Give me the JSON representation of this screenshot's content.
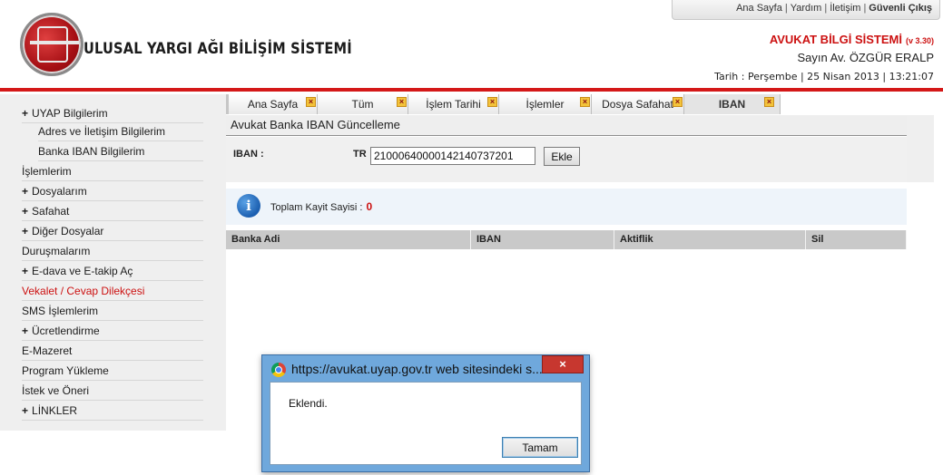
{
  "header": {
    "site_title": "ULUSAL YARGI AĞI BİLİŞİM SİSTEMİ",
    "top_links": [
      "Ana Sayfa",
      "Yardım",
      "İletişim"
    ],
    "logout": "Güvenli Çıkış",
    "system_name": "AVUKAT BİLGİ SİSTEMİ",
    "version": "(v 3.30)",
    "user": "Sayın Av. ÖZGÜR ERALP",
    "date": "Tarih : Perşembe | 25 Nisan 2013 | 13:21:07"
  },
  "sidebar": {
    "items": [
      {
        "label": "UYAP Bilgilerim",
        "plus": "+"
      },
      {
        "label": "Adres ve İletişim Bilgilerim"
      },
      {
        "label": "Banka IBAN Bilgilerim"
      },
      {
        "label": "İşlemlerim"
      },
      {
        "label": "Dosyalarım",
        "plus": "+"
      },
      {
        "label": "Safahat",
        "plus": "+"
      },
      {
        "label": "Diğer Dosyalar",
        "plus": "+"
      },
      {
        "label": "Duruşmalarım"
      },
      {
        "label": "E-dava ve E-takip Aç",
        "plus": "+"
      },
      {
        "label": "Vekalet / Cevap Dilekçesi"
      },
      {
        "label": "SMS İşlemlerim"
      },
      {
        "label": "Ücretlendirme",
        "plus": "+"
      },
      {
        "label": "E-Mazeret"
      },
      {
        "label": "Program Yükleme"
      },
      {
        "label": "İstek ve Öneri"
      },
      {
        "label": "LİNKLER",
        "plus": "+"
      }
    ]
  },
  "tabs": [
    {
      "label": "Ana Sayfa"
    },
    {
      "label": "Tüm"
    },
    {
      "label": "İşlem Tarihi"
    },
    {
      "label": "İşlemler"
    },
    {
      "label": "Dosya Safahat"
    },
    {
      "label": "IBAN"
    }
  ],
  "tab_close_glyph": "×",
  "main": {
    "panel_title": "Avukat Banka IBAN Güncelleme",
    "iban_label": "IBAN :",
    "country_code": "TR",
    "iban_value": "21000640000142140737201",
    "add_button": "Ekle",
    "info_text": "Toplam Kayit Sayisi :",
    "record_count": "0",
    "columns": [
      "Banka Adi",
      "IBAN",
      "Aktiflik",
      "Sil"
    ]
  },
  "dialog": {
    "title": "https://avukat.uyap.gov.tr web sitesindeki s...",
    "close_glyph": "×",
    "message": "Eklendi.",
    "ok_button": "Tamam"
  },
  "colors": {
    "accent_red": "#d41818",
    "dialog_frame": "#6fa8dc",
    "info_icon": "#1c5fb0"
  }
}
